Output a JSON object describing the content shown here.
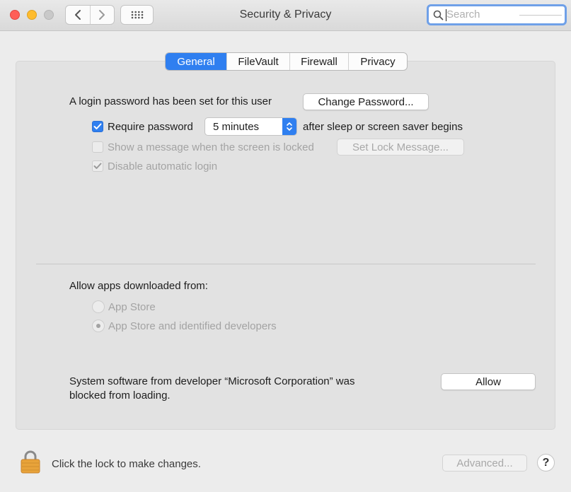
{
  "window": {
    "title": "Security & Privacy"
  },
  "search": {
    "placeholder": "Search"
  },
  "tabs": [
    {
      "label": "General",
      "active": true
    },
    {
      "label": "FileVault",
      "active": false
    },
    {
      "label": "Firewall",
      "active": false
    },
    {
      "label": "Privacy",
      "active": false
    }
  ],
  "general": {
    "login_text": "A login password has been set for this user",
    "change_password_label": "Change Password...",
    "require_password": {
      "label": "Require password",
      "checked": true
    },
    "require_password_delay": "5 minutes",
    "after_sleep_text": "after sleep or screen saver begins",
    "show_message": {
      "label": "Show a message when the screen is locked",
      "checked": false,
      "enabled": false
    },
    "set_lock_message_label": "Set Lock Message...",
    "disable_auto_login": {
      "label": "Disable automatic login",
      "checked": true,
      "enabled": false
    }
  },
  "downloads": {
    "heading": "Allow apps downloaded from:",
    "options": [
      {
        "label": "App Store",
        "selected": false
      },
      {
        "label": "App Store and identified developers",
        "selected": true
      }
    ]
  },
  "blocked": {
    "line1": "System software from developer “Microsoft Corporation” was",
    "line2": "blocked from loading.",
    "allow_label": "Allow"
  },
  "footer": {
    "lock_text": "Click the lock to make changes.",
    "advanced_label": "Advanced...",
    "help_label": "?"
  },
  "colors": {
    "accent": "#2f7ff0",
    "close": "#ff5f57",
    "minimize": "#febc2e",
    "lock": "#e8a33a"
  },
  "icons": [
    "close-icon",
    "minimize-icon",
    "zoom-icon",
    "chevron-left-icon",
    "chevron-right-icon",
    "grid-icon",
    "search-icon",
    "checkmark-icon",
    "stepper-icon",
    "lock-icon",
    "help-icon"
  ]
}
